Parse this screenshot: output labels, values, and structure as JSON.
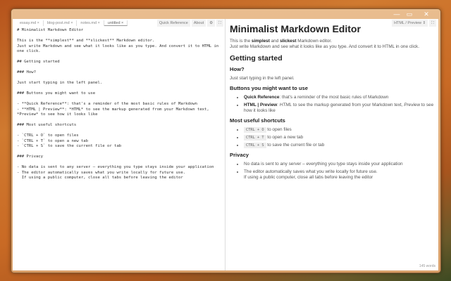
{
  "tabs": [
    "essay.md ×",
    "blog-post.md ×",
    "notes.md ×",
    "untitled ×"
  ],
  "toolbar": {
    "quick_reference": "Quick Reference",
    "about": "About",
    "settings": "⚙",
    "fullscreen": "⛶",
    "view_mode": "HTML / Preview ⇕",
    "fullscreen_right": "⛶"
  },
  "window": {
    "minimize": "—",
    "maximize": "▭",
    "close": "✕"
  },
  "editor": {
    "text": "# Minimalist Markdown Editor\n\nThis is the **simplest** and **slickest** Markdown editor.\nJust write Markdown and see what it looks like as you type. And convert it to HTML in one click.\n\n## Getting started\n\n### How?\n\nJust start typing in the left panel.\n\n### Buttons you might want to use\n\n- **Quick Reference**: that's a reminder of the most basic rules of Markdown\n- **HTML | Preview**: *HTML* to see the markup generated from your Markdown text, *Preview* to see how it looks like\n\n### Most useful shortcuts\n\n- `CTRL + O` to open files\n- `CTRL + T` to open a new tab\n- `CTRL + S` to save the current file or tab\n\n### Privacy\n\n- No data is sent to any server – everything you type stays inside your application\n- The editor automatically saves what you write locally for future use.\n  If using a public computer, close all tabs before leaving the editor"
  },
  "preview": {
    "h1": "Minimalist Markdown Editor",
    "p1a": "This is the ",
    "simplest": "simplest",
    "p1b": " and ",
    "slickest": "slickest",
    "p1c": " Markdown editor.",
    "p1d": "Just write Markdown and see what it looks like as you type. And convert it to HTML in one click.",
    "h2": "Getting started",
    "h3_how": "How?",
    "p_how": "Just start typing in the left panel.",
    "h3_buttons": "Buttons you might want to use",
    "b1_bold": "Quick Reference",
    "b1_text": ": that's a reminder of the most basic rules of Markdown",
    "b2_bold": "HTML | Preview",
    "b2_a": ": ",
    "b2_em1": "HTML",
    "b2_b": " to see the markup generated from your Markdown text, ",
    "b2_em2": "Preview",
    "b2_c": " to see how it looks like",
    "h3_shortcuts": "Most useful shortcuts",
    "shortcuts": [
      {
        "key": "CTRL + O",
        "text": " to open files"
      },
      {
        "key": "CTRL + T",
        "text": " to open a new tab"
      },
      {
        "key": "CTRL + S",
        "text": " to save the current file or tab"
      }
    ],
    "h3_privacy": "Privacy",
    "priv1": "No data is sent to any server – everything you type stays inside your application",
    "priv2a": "The editor automatically saves what you write locally for future use.",
    "priv2b": "If using a public computer, close all tabs before leaving the editor"
  },
  "word_count": "145 words"
}
